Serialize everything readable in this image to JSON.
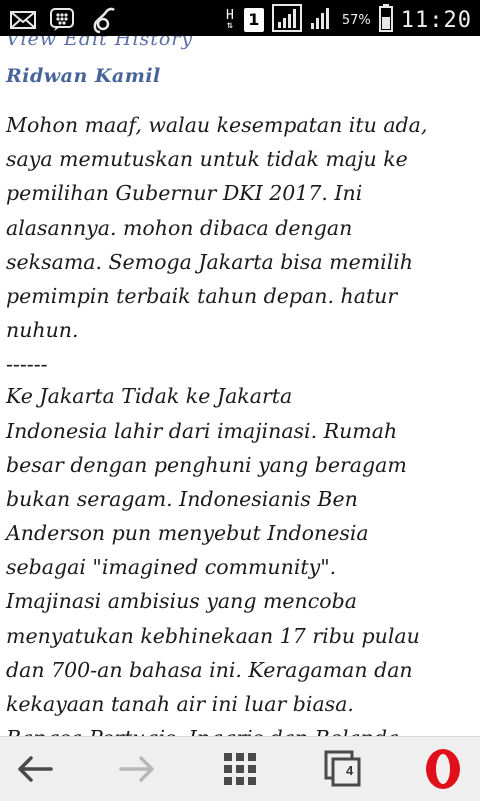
{
  "status_bar": {
    "network_type": "H",
    "sim_slot": "1",
    "battery_percent": "57%",
    "time": "11:20",
    "icons": [
      "mail-icon",
      "bbm-icon",
      "link-icon",
      "signal-icon",
      "signal-icon-2",
      "battery-icon"
    ]
  },
  "page": {
    "view_edit_history": "View Edit History",
    "author": "Ridwan Kamil",
    "lines": [
      "Mohon maaf, walau kesempatan itu ada,",
      "saya memutuskan untuk tidak maju ke",
      "pemilihan Gubernur DKI 2017. Ini",
      "alasannya. mohon dibaca dengan",
      "seksama. Semoga Jakarta bisa memilih",
      "pemimpin terbaik tahun depan. hatur",
      "nuhun.",
      "------",
      "Ke Jakarta Tidak ke Jakarta",
      "Indonesia lahir dari imajinasi. Rumah",
      "besar dengan penghuni yang beragam",
      "bukan seragam. Indonesianis Ben",
      "Anderson pun menyebut Indonesia",
      "sebagai \"imagined community\".",
      "Imajinasi ambisius yang mencoba",
      "menyatukan kebhinekaan 17 ribu pulau",
      "dan 700-an bahasa ini. Keragaman dan",
      "kekayaan tanah air ini luar biasa.",
      "Bangsa Portugis, Inggris dan Belanda"
    ]
  },
  "bottom_bar": {
    "tab_count": "4",
    "colors": {
      "opera_red": "#e0101a",
      "icon_gray": "#4a4a4a",
      "icon_disabled": "#b8b8b8"
    }
  }
}
